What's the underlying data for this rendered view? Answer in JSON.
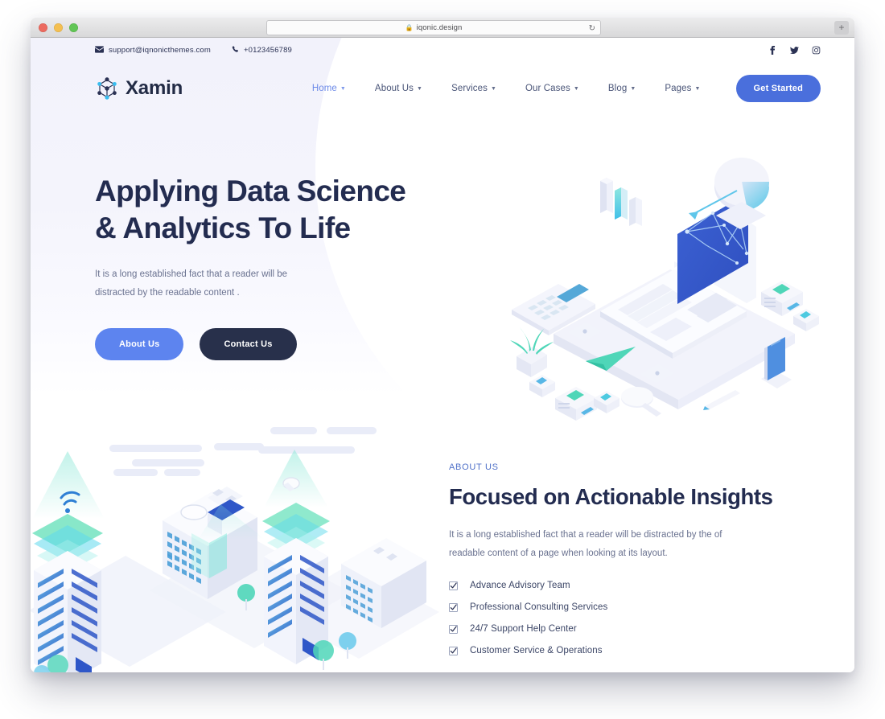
{
  "browser": {
    "url": "iqonic.design",
    "lock_icon": "lock-icon",
    "reload_icon": "reload-icon",
    "newtab_label": "+",
    "traffic_lights": [
      "close-red",
      "minimize-yellow",
      "zoom-green"
    ]
  },
  "topbar": {
    "email": "support@iqnonicthemes.com",
    "email_icon": "envelope-icon",
    "phone": "+0123456789",
    "phone_icon": "phone-icon",
    "socials": [
      {
        "name": "facebook-icon",
        "label": "Facebook"
      },
      {
        "name": "twitter-icon",
        "label": "Twitter"
      },
      {
        "name": "instagram-icon",
        "label": "Instagram"
      }
    ]
  },
  "header": {
    "brand_name": "Xamin",
    "brand_logo_icon": "molecule-logo-icon",
    "nav": [
      {
        "label": "Home",
        "has_caret": true,
        "active": true
      },
      {
        "label": "About Us",
        "has_caret": true,
        "active": false
      },
      {
        "label": "Services",
        "has_caret": true,
        "active": false
      },
      {
        "label": "Our Cases",
        "has_caret": true,
        "active": false
      },
      {
        "label": "Blog",
        "has_caret": true,
        "active": false
      },
      {
        "label": "Pages",
        "has_caret": true,
        "active": false
      }
    ],
    "cta_label": "Get Started"
  },
  "hero": {
    "title_line1": "Applying Data Science",
    "title_line2": "& Analytics To Life",
    "subtitle": "It is a long established fact that a reader will be distracted by the readable content .",
    "primary_button": "About Us",
    "secondary_button": "Contact Us",
    "illustration_name": "isometric-laptop-analytics-illustration"
  },
  "about": {
    "eyebrow": "ABOUT US",
    "title": "Focused on Actionable Insights",
    "paragraph": "It is a long established fact that a reader will be distracted by the of readable content of a page when looking at its layout.",
    "illustration_name": "isometric-smart-city-illustration",
    "checklist": [
      "Advance Advisory Team",
      "Professional Consulting Services",
      "24/7 Support Help Center",
      "Customer Service & Operations"
    ]
  },
  "colors": {
    "accent_blue": "#4a6fdc",
    "button_blue": "#5d84ef",
    "dark_navy": "#28304b",
    "heading_navy": "#232c50",
    "body_gray": "#6a7290",
    "eyebrow_blue": "#5172c9",
    "hero_bg": "#f2f2fb"
  }
}
